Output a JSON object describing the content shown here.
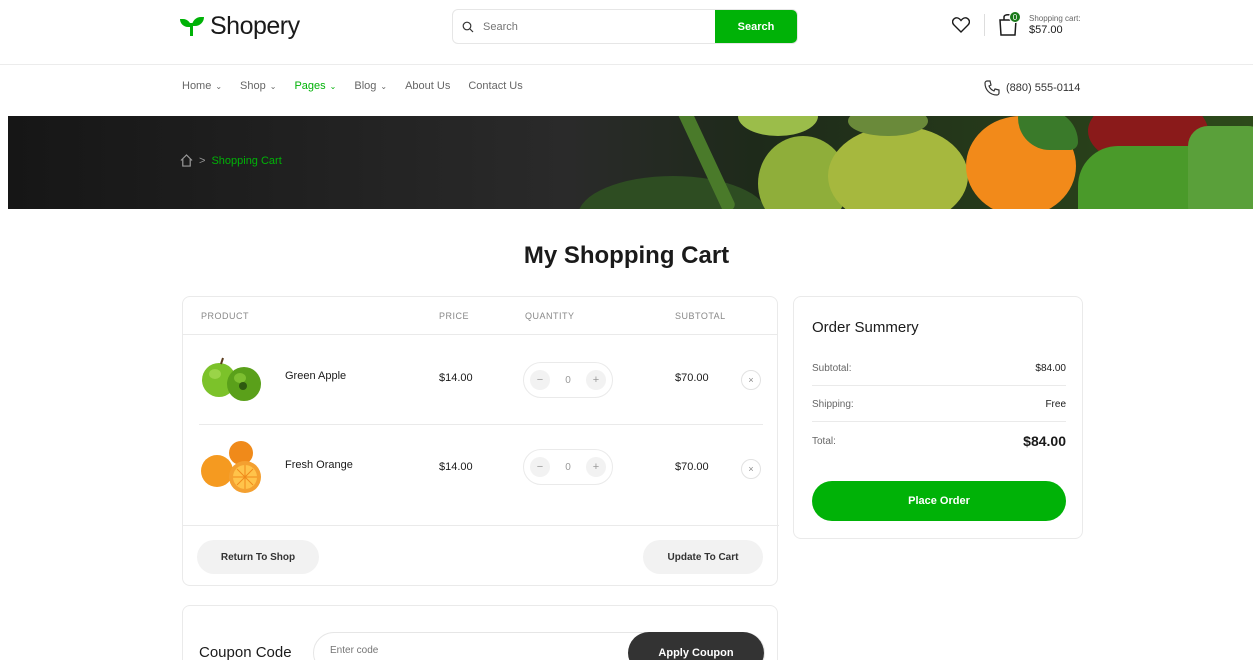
{
  "header": {
    "logo": "Shopery",
    "search_placeholder": "Search",
    "search_button": "Search",
    "cart_label": "Shopping cart:",
    "cart_total": "$57.00",
    "cart_count": "0"
  },
  "nav": {
    "items": [
      {
        "label": "Home",
        "dropdown": true,
        "active": false
      },
      {
        "label": "Shop",
        "dropdown": true,
        "active": false
      },
      {
        "label": "Pages",
        "dropdown": true,
        "active": true
      },
      {
        "label": "Blog",
        "dropdown": true,
        "active": false
      },
      {
        "label": "About Us",
        "dropdown": false,
        "active": false
      },
      {
        "label": "Contact Us",
        "dropdown": false,
        "active": false
      }
    ],
    "phone": "(880) 555-0114"
  },
  "breadcrumb": {
    "separator": ">",
    "current": "Shopping Cart"
  },
  "page_title": "My Shopping Cart",
  "cart": {
    "headers": {
      "product": "PRODUCT",
      "price": "PRICE",
      "quantity": "QUANTITY",
      "subtotal": "SUBTOTAL"
    },
    "items": [
      {
        "name": "Green Apple",
        "price": "$14.00",
        "qty": "0",
        "subtotal": "$70.00",
        "minus": "−",
        "plus": "+",
        "remove": "×"
      },
      {
        "name": "Fresh Orange",
        "price": "$14.00",
        "qty": "0",
        "subtotal": "$70.00",
        "minus": "−",
        "plus": "+",
        "remove": "×"
      }
    ],
    "return_button": "Return To Shop",
    "update_button": "Update To Cart"
  },
  "summary": {
    "title": "Order Summery",
    "subtotal_label": "Subtotal:",
    "subtotal_value": "$84.00",
    "shipping_label": "Shipping:",
    "shipping_value": "Free",
    "total_label": "Total:",
    "total_value": "$84.00",
    "place_order": "Place Order"
  },
  "coupon": {
    "label": "Coupon Code",
    "placeholder": "Enter code",
    "button": "Apply Coupon"
  },
  "colors": {
    "brand": "#00b207",
    "dark": "#333333"
  }
}
